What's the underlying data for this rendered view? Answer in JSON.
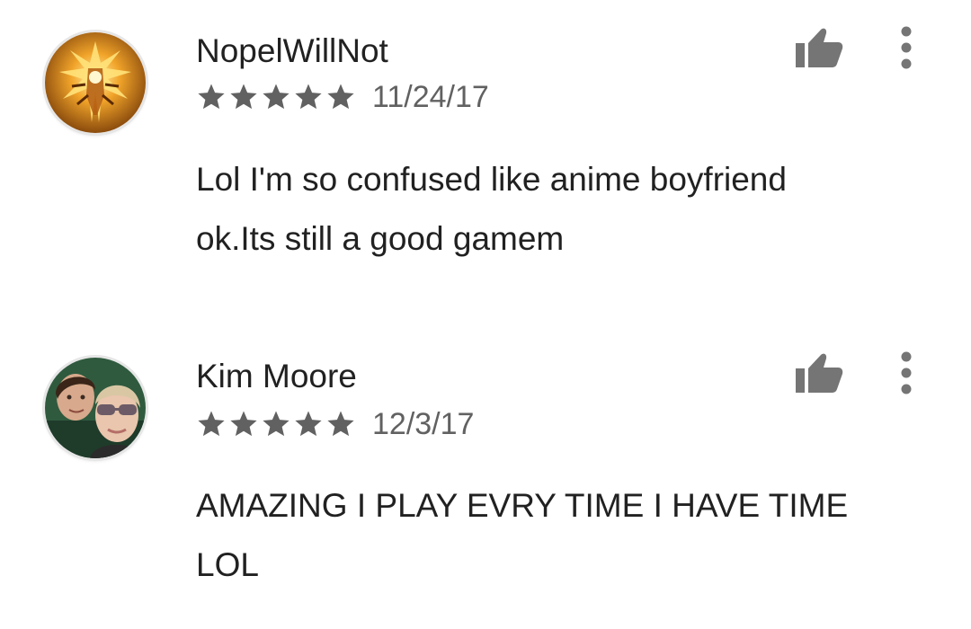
{
  "reviews": [
    {
      "author": "NopelWillNot",
      "rating": 5,
      "date": "11/24/17",
      "text": "Lol I'm so confused like anime boyfriend\nok.Its still a good gamem",
      "avatar_icon": "anime-character-avatar",
      "helpful_icon": "thumbs-up-icon",
      "menu_icon": "more-vert-icon"
    },
    {
      "author": "Kim Moore",
      "rating": 5,
      "date": "12/3/17",
      "text": "AMAZING I PLAY EVRY TIME I HAVE TIME\nLOL",
      "avatar_icon": "two-women-photo-avatar",
      "helpful_icon": "thumbs-up-icon",
      "menu_icon": "more-vert-icon"
    }
  ],
  "colors": {
    "text_primary": "#212121",
    "text_secondary": "#616161",
    "star": "#616161",
    "icon": "#757575"
  }
}
